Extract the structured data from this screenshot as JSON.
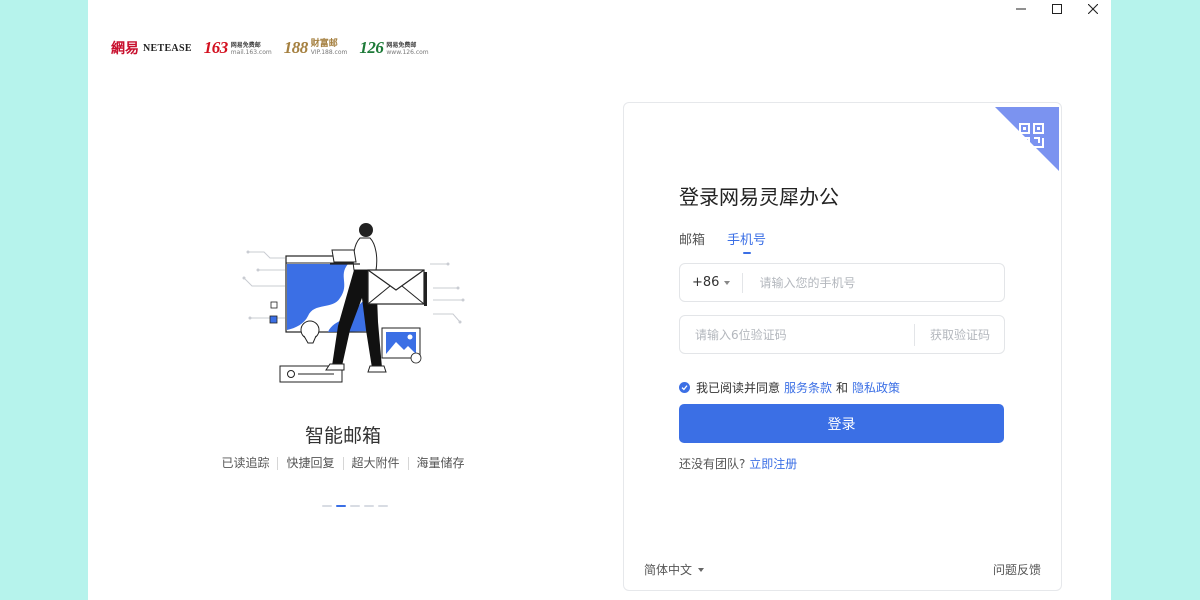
{
  "window": {
    "controls": [
      {
        "name": "minimize-button",
        "icon": "minimize-icon"
      },
      {
        "name": "maximize-button",
        "icon": "maximize-icon"
      },
      {
        "name": "close-button",
        "icon": "close-icon"
      }
    ]
  },
  "logos": {
    "netease_cn": "網易",
    "netease_en": "NETEASE",
    "l163": {
      "big": "163",
      "line1": "网易免费邮",
      "line2": "mail.163.com"
    },
    "l188": {
      "big": "188",
      "line1": "财富邮",
      "line2": "VIP.188.com"
    },
    "l126": {
      "big": "126",
      "line1": "网易免费邮",
      "line2": "www.126.com"
    }
  },
  "promo": {
    "title": "智能邮箱",
    "features": [
      "已读追踪",
      "快捷回复",
      "超大附件",
      "海量储存"
    ],
    "carousel_active_index": 1,
    "carousel_count": 5
  },
  "login": {
    "title": "登录网易灵犀办公",
    "tabs": [
      {
        "label": "邮箱",
        "active": false
      },
      {
        "label": "手机号",
        "active": true
      }
    ],
    "country_code": "+86",
    "phone_placeholder": "请输入您的手机号",
    "code_placeholder": "请输入6位验证码",
    "get_code_label": "获取验证码",
    "agree_prefix": "我已阅读并同意",
    "terms_link": "服务条款",
    "and": "和",
    "privacy_link": "隐私政策",
    "login_button": "登录",
    "no_team_text": "还没有团队?",
    "register_link": "立即注册",
    "language": "简体中文",
    "feedback": "问题反馈",
    "qr_icon": "qr-code-icon"
  },
  "colors": {
    "accent": "#3b6fe5",
    "qr_corner": "#7b93f0",
    "desktop_bg": "#b6f3ec"
  }
}
